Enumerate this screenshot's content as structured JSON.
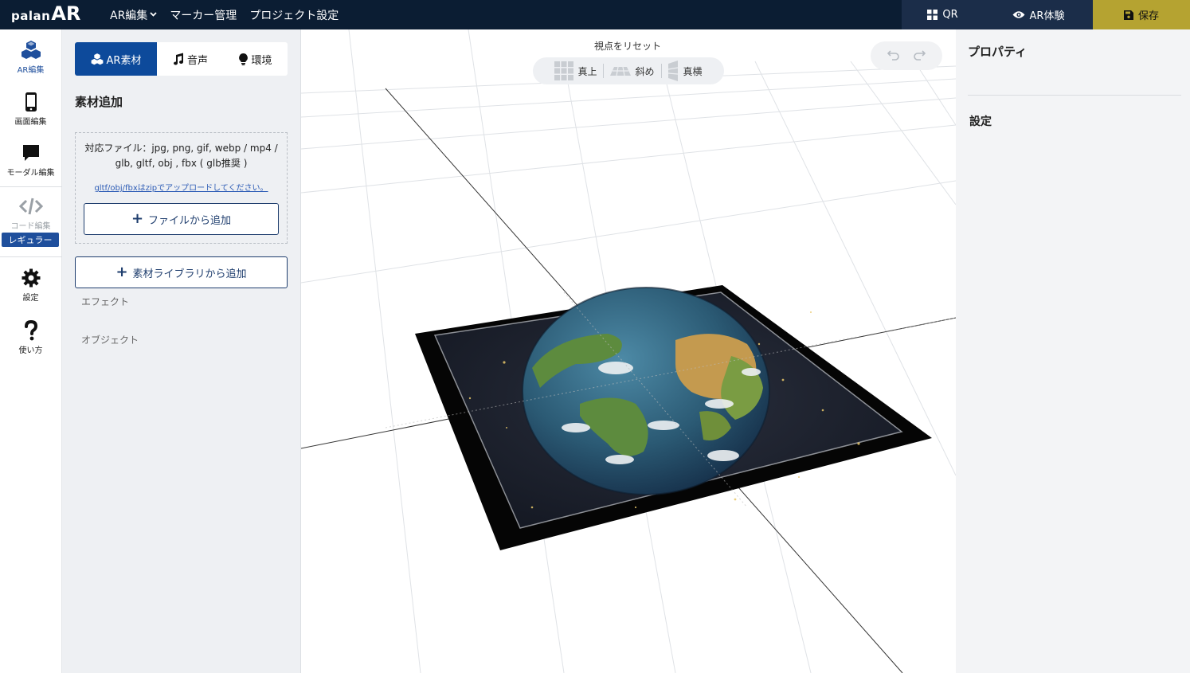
{
  "app": {
    "logo_small": "palan",
    "logo_big": "AR"
  },
  "topnav": {
    "items": [
      {
        "label": "AR編集"
      },
      {
        "label": "マーカー管理"
      },
      {
        "label": "プロジェクト設定"
      }
    ]
  },
  "topright": {
    "qr_label": "QR",
    "ar_label": "AR体験",
    "save_label": "保存"
  },
  "sidebar": {
    "items": [
      {
        "label": "AR編集",
        "icon": "cubes-icon"
      },
      {
        "label": "画面編集",
        "icon": "smartphone-icon"
      },
      {
        "label": "モーダル編集",
        "icon": "speech-bubble-icon"
      },
      {
        "label": "コード編集",
        "icon": "code-icon"
      },
      {
        "label": "設定",
        "icon": "gear-icon"
      },
      {
        "label": "使い方",
        "icon": "question-icon"
      }
    ],
    "badge": "レギュラー"
  },
  "panel": {
    "tabs": [
      {
        "label": "AR素材",
        "icon": "cubes-icon"
      },
      {
        "label": "音声",
        "icon": "music-note-icon"
      },
      {
        "label": "環境",
        "icon": "lightbulb-icon"
      }
    ],
    "title": "素材追加",
    "supported_line1": "対応ファイル：jpg, png, gif, webp / mp4 /",
    "supported_line2": "glb, gltf, obj , fbx ( glb推奨 )",
    "zip_note": "gltf/obj/fbxはzipでアップロードしてください。",
    "add_file_label": "ファイルから追加",
    "add_library_label": "素材ライブラリから追加",
    "section_effect": "エフェクト",
    "section_object": "オブジェクト"
  },
  "viewport": {
    "reset_label": "視点をリセット",
    "views": [
      {
        "label": "真上",
        "icon": "top-view-icon"
      },
      {
        "label": "斜め",
        "icon": "oblique-view-icon"
      },
      {
        "label": "真横",
        "icon": "side-view-icon"
      }
    ],
    "undo_icon": "undo-icon",
    "redo_icon": "redo-icon"
  },
  "properties": {
    "title": "プロパティ",
    "setting": "設定"
  },
  "colors": {
    "topbar": "#0b1d33",
    "save": "#b5a331",
    "accent": "#0d4a9b",
    "panel_bg": "#eef0f3"
  }
}
